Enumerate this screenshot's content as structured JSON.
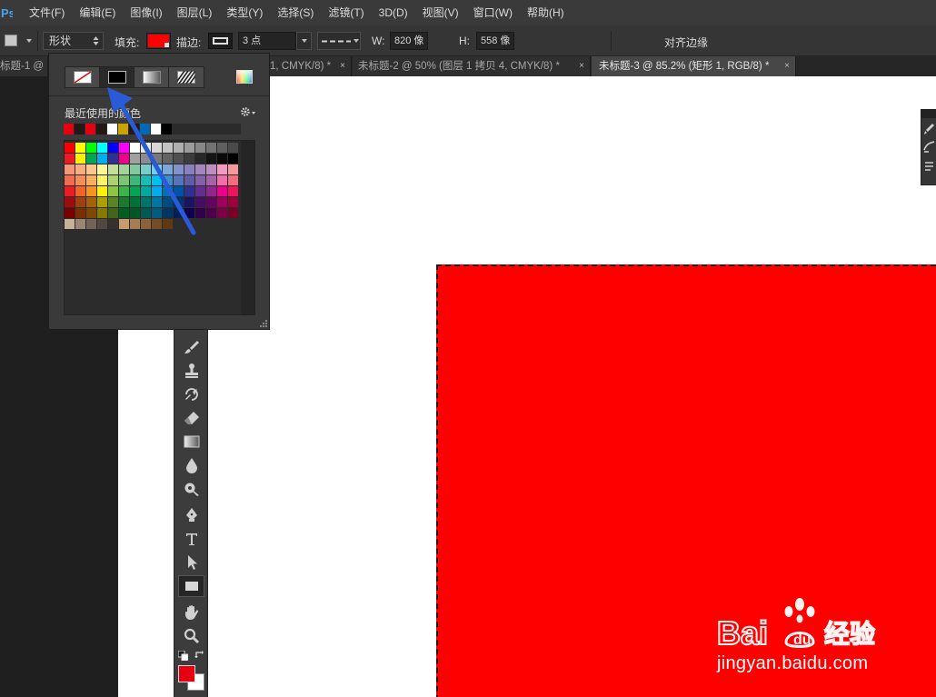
{
  "menubar": {
    "logo": "Ps",
    "items": [
      "文件(F)",
      "编辑(E)",
      "图像(I)",
      "图层(L)",
      "类型(Y)",
      "选择(S)",
      "滤镜(T)",
      "3D(D)",
      "视图(V)",
      "窗口(W)",
      "帮助(H)"
    ]
  },
  "options": {
    "mode_value": "形状",
    "fill_label": "填充:",
    "fill_color": "#fe0000",
    "stroke_label": "描边:",
    "stroke_size": "3 点",
    "w_label": "W:",
    "w_value": "820 像",
    "h_label": "H:",
    "h_value": "558 像",
    "align_edges_label": "对齐边缘"
  },
  "tabs": [
    {
      "title": "标题-1 @"
    },
    {
      "title": "1, CMYK/8) *"
    },
    {
      "title": "未标题-2 @ 50% (图层 1 拷贝 4, CMYK/8) *"
    },
    {
      "title": "未标题-3 @ 85.2% (矩形 1, RGB/8) *"
    }
  ],
  "tab_close_glyph": "×",
  "swatches": {
    "recent_label": "最近使用的颜色",
    "recent": [
      "#e60012",
      "#231815",
      "#e60012",
      "#231815",
      "#ffffff",
      "#c9a400",
      "#231815",
      "#0068b7",
      "#ffffff",
      "#000000"
    ],
    "grid": [
      [
        "#ff0000",
        "#ffff00",
        "#00ff00",
        "#00ffff",
        "#0000ff",
        "#ff00ff",
        "#ffffff",
        "#ebebeb",
        "#d7d7d7",
        "#c3c3c3",
        "#afafaf",
        "#9b9b9b",
        "#878787",
        "#737373",
        "#5f5f5f",
        "#4b4b4b"
      ],
      [
        "#ec1c24",
        "#fff200",
        "#00a651",
        "#00aeef",
        "#2e3192",
        "#ec008c",
        "#a0a0a0",
        "#8c8c8c",
        "#787878",
        "#646464",
        "#505050",
        "#3c3c3c",
        "#282828",
        "#141414",
        "#0a0a0a",
        "#000000"
      ],
      [
        "#f7977a",
        "#f9ad81",
        "#fdc68a",
        "#fff799",
        "#c4df9b",
        "#a3d39c",
        "#82ca9d",
        "#7accc8",
        "#6dcff6",
        "#7da7d9",
        "#8393ca",
        "#8781bd",
        "#a187be",
        "#bc8dbf",
        "#f49ac2",
        "#f6989d"
      ],
      [
        "#f26c4f",
        "#f68e55",
        "#fbaf5c",
        "#fff467",
        "#acd372",
        "#7cc576",
        "#3bb878",
        "#1abbb4",
        "#00bff3",
        "#438cca",
        "#5574b9",
        "#605ca8",
        "#855fa8",
        "#a763a8",
        "#f06eaa",
        "#f26d7d"
      ],
      [
        "#ed1c24",
        "#f26522",
        "#f7941d",
        "#fff200",
        "#8dc63f",
        "#39b54a",
        "#00a651",
        "#00a99d",
        "#00aeef",
        "#0072bc",
        "#0054a6",
        "#2e3192",
        "#662d91",
        "#92278f",
        "#ec008c",
        "#ed145b"
      ],
      [
        "#9e0b0f",
        "#a0410d",
        "#a36209",
        "#aba000",
        "#598527",
        "#1a7b30",
        "#007236",
        "#00746b",
        "#0076a3",
        "#004b80",
        "#003471",
        "#1b1464",
        "#440e62",
        "#630460",
        "#9e005d",
        "#9e0039"
      ],
      [
        "#790000",
        "#7b2e00",
        "#7d4900",
        "#827b00",
        "#406618",
        "#005e20",
        "#005826",
        "#005952",
        "#005b7f",
        "#003663",
        "#002157",
        "#0d004c",
        "#32004b",
        "#4b0049",
        "#7b0046",
        "#7a0026"
      ],
      [
        "#c7b299",
        "#998675",
        "#736357",
        "#534741",
        "#37302d",
        "#c69c6d",
        "#a67c52",
        "#8c6239",
        "#754c24",
        "#603913"
      ]
    ]
  }
}
